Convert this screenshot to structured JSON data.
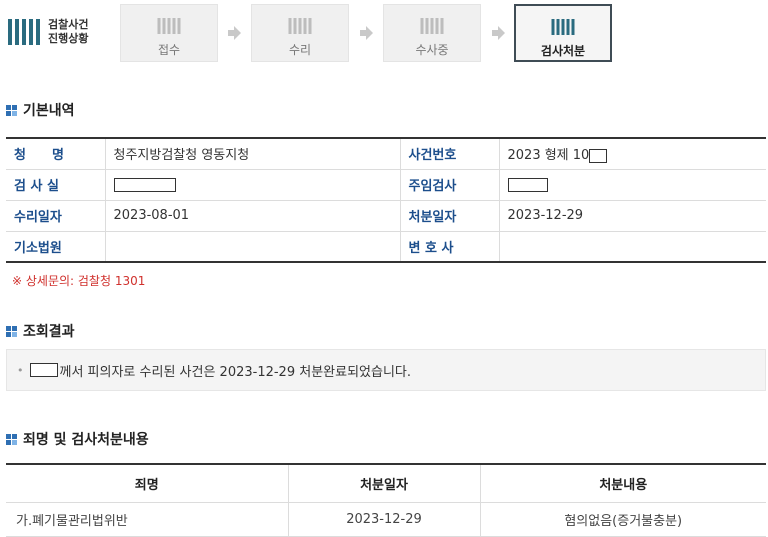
{
  "logo": {
    "line1": "검찰사건",
    "line2": "진행상황"
  },
  "steps": [
    {
      "label": "접수",
      "active": false
    },
    {
      "label": "수리",
      "active": false
    },
    {
      "label": "수사중",
      "active": false
    },
    {
      "label": "검사처분",
      "active": true
    }
  ],
  "basic": {
    "title": "기본내역",
    "rows": [
      {
        "l1": "청　　명",
        "v1": "청주지방검찰청 영동지청",
        "l2": "사건번호",
        "v2": "2023 형제 10"
      },
      {
        "l1": "검 사 실",
        "v1": "",
        "l2": "주임검사",
        "v2": ""
      },
      {
        "l1": "수리일자",
        "v1": "2023-08-01",
        "l2": "처분일자",
        "v2": "2023-12-29"
      },
      {
        "l1": "기소법원",
        "v1": "",
        "l2": "변 호 사",
        "v2": ""
      }
    ],
    "notice": "※ 상세문의: 검찰청 1301"
  },
  "result": {
    "title": "조회결과",
    "text": "께서 피의자로 수리된 사건은 2023-12-29 처분완료되었습니다."
  },
  "charges": {
    "title": "죄명 및 검사처분내용",
    "headers": [
      "죄명",
      "처분일자",
      "처분내용"
    ],
    "rows": [
      {
        "name": "가.폐기물관리법위반",
        "date": "2023-12-29",
        "result": "혐의없음(증거불충분)"
      }
    ]
  },
  "colors": {
    "label_blue": "#1c4e8c",
    "notice_red": "#d0312d",
    "active_border": "#3f4c55",
    "icon_teal": "#2a6b7f"
  }
}
